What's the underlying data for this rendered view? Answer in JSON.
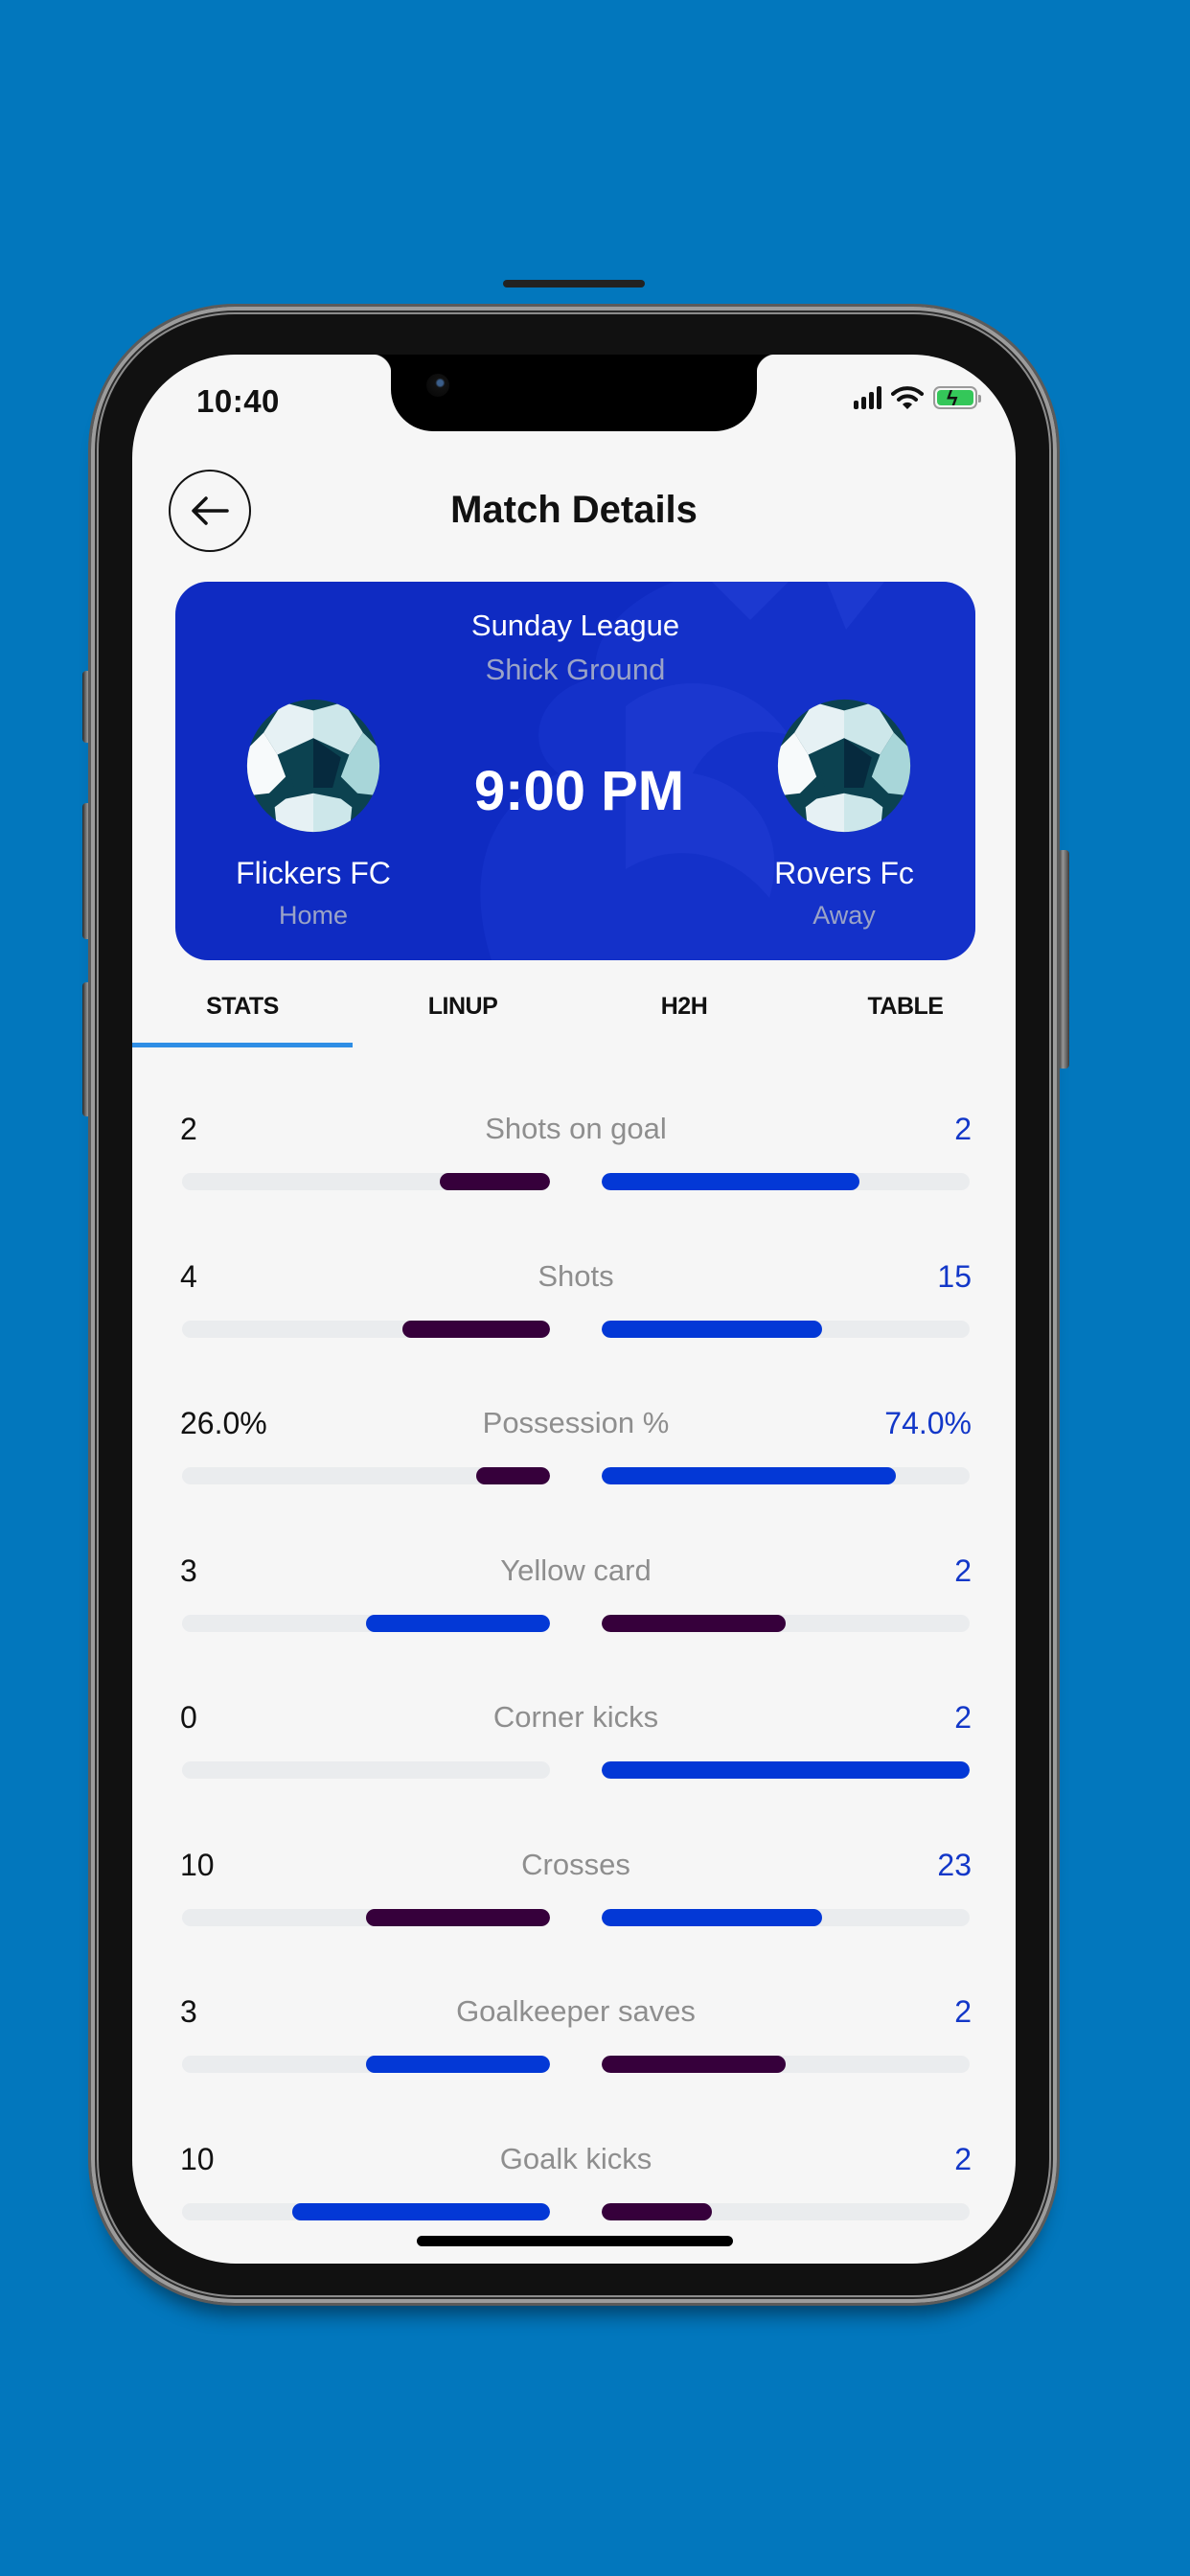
{
  "status_bar": {
    "time": "10:40",
    "signal_icon": "cellular-signal-icon",
    "wifi_icon": "wifi-icon",
    "battery_icon": "battery-charging-icon",
    "battery_color": "#34c759"
  },
  "header": {
    "title": "Match Details",
    "back_icon": "arrow-left-icon"
  },
  "match": {
    "league": "Sunday League",
    "ground": "Shick Ground",
    "kickoff": "9:00 PM",
    "card_color": "#0f2bc2",
    "home": {
      "name": "Flickers FC",
      "side": "Home",
      "crest_icon": "soccer-ball-icon"
    },
    "away": {
      "name": "Rovers Fc",
      "side": "Away",
      "crest_icon": "soccer-ball-icon"
    }
  },
  "tabs": [
    {
      "label": "STATS",
      "active": true
    },
    {
      "label": "LINUP",
      "active": false
    },
    {
      "label": "H2H",
      "active": false
    },
    {
      "label": "TABLE",
      "active": false
    }
  ],
  "colors": {
    "accent_tab": "#2f8ee5",
    "blue_bar": "#0338d6",
    "purple_bar": "#36003b",
    "away_value": "#1237c8",
    "track": "#eaecee"
  },
  "stats": [
    {
      "label": "Shots on goal",
      "home": "2",
      "away": "2",
      "home_fill": 0.3,
      "away_fill": 0.7,
      "home_color": "purple",
      "away_color": "blue"
    },
    {
      "label": "Shots",
      "home": "4",
      "away": "15",
      "home_fill": 0.4,
      "away_fill": 0.6,
      "home_color": "purple",
      "away_color": "blue"
    },
    {
      "label": "Possession %",
      "home": "26.0%",
      "away": "74.0%",
      "home_fill": 0.2,
      "away_fill": 0.8,
      "home_color": "purple",
      "away_color": "blue"
    },
    {
      "label": "Yellow card",
      "home": "3",
      "away": "2",
      "home_fill": 0.5,
      "away_fill": 0.5,
      "home_color": "blue",
      "away_color": "purple"
    },
    {
      "label": "Corner kicks",
      "home": "0",
      "away": "2",
      "home_fill": 0.0,
      "away_fill": 1.0,
      "home_color": "purple",
      "away_color": "blue"
    },
    {
      "label": "Crosses",
      "home": "10",
      "away": "23",
      "home_fill": 0.5,
      "away_fill": 0.6,
      "home_color": "purple",
      "away_color": "blue"
    },
    {
      "label": "Goalkeeper saves",
      "home": "3",
      "away": "2",
      "home_fill": 0.5,
      "away_fill": 0.5,
      "home_color": "blue",
      "away_color": "purple"
    },
    {
      "label": "Goalk kicks",
      "home": "10",
      "away": "2",
      "home_fill": 0.7,
      "away_fill": 0.3,
      "home_color": "blue",
      "away_color": "purple"
    }
  ]
}
